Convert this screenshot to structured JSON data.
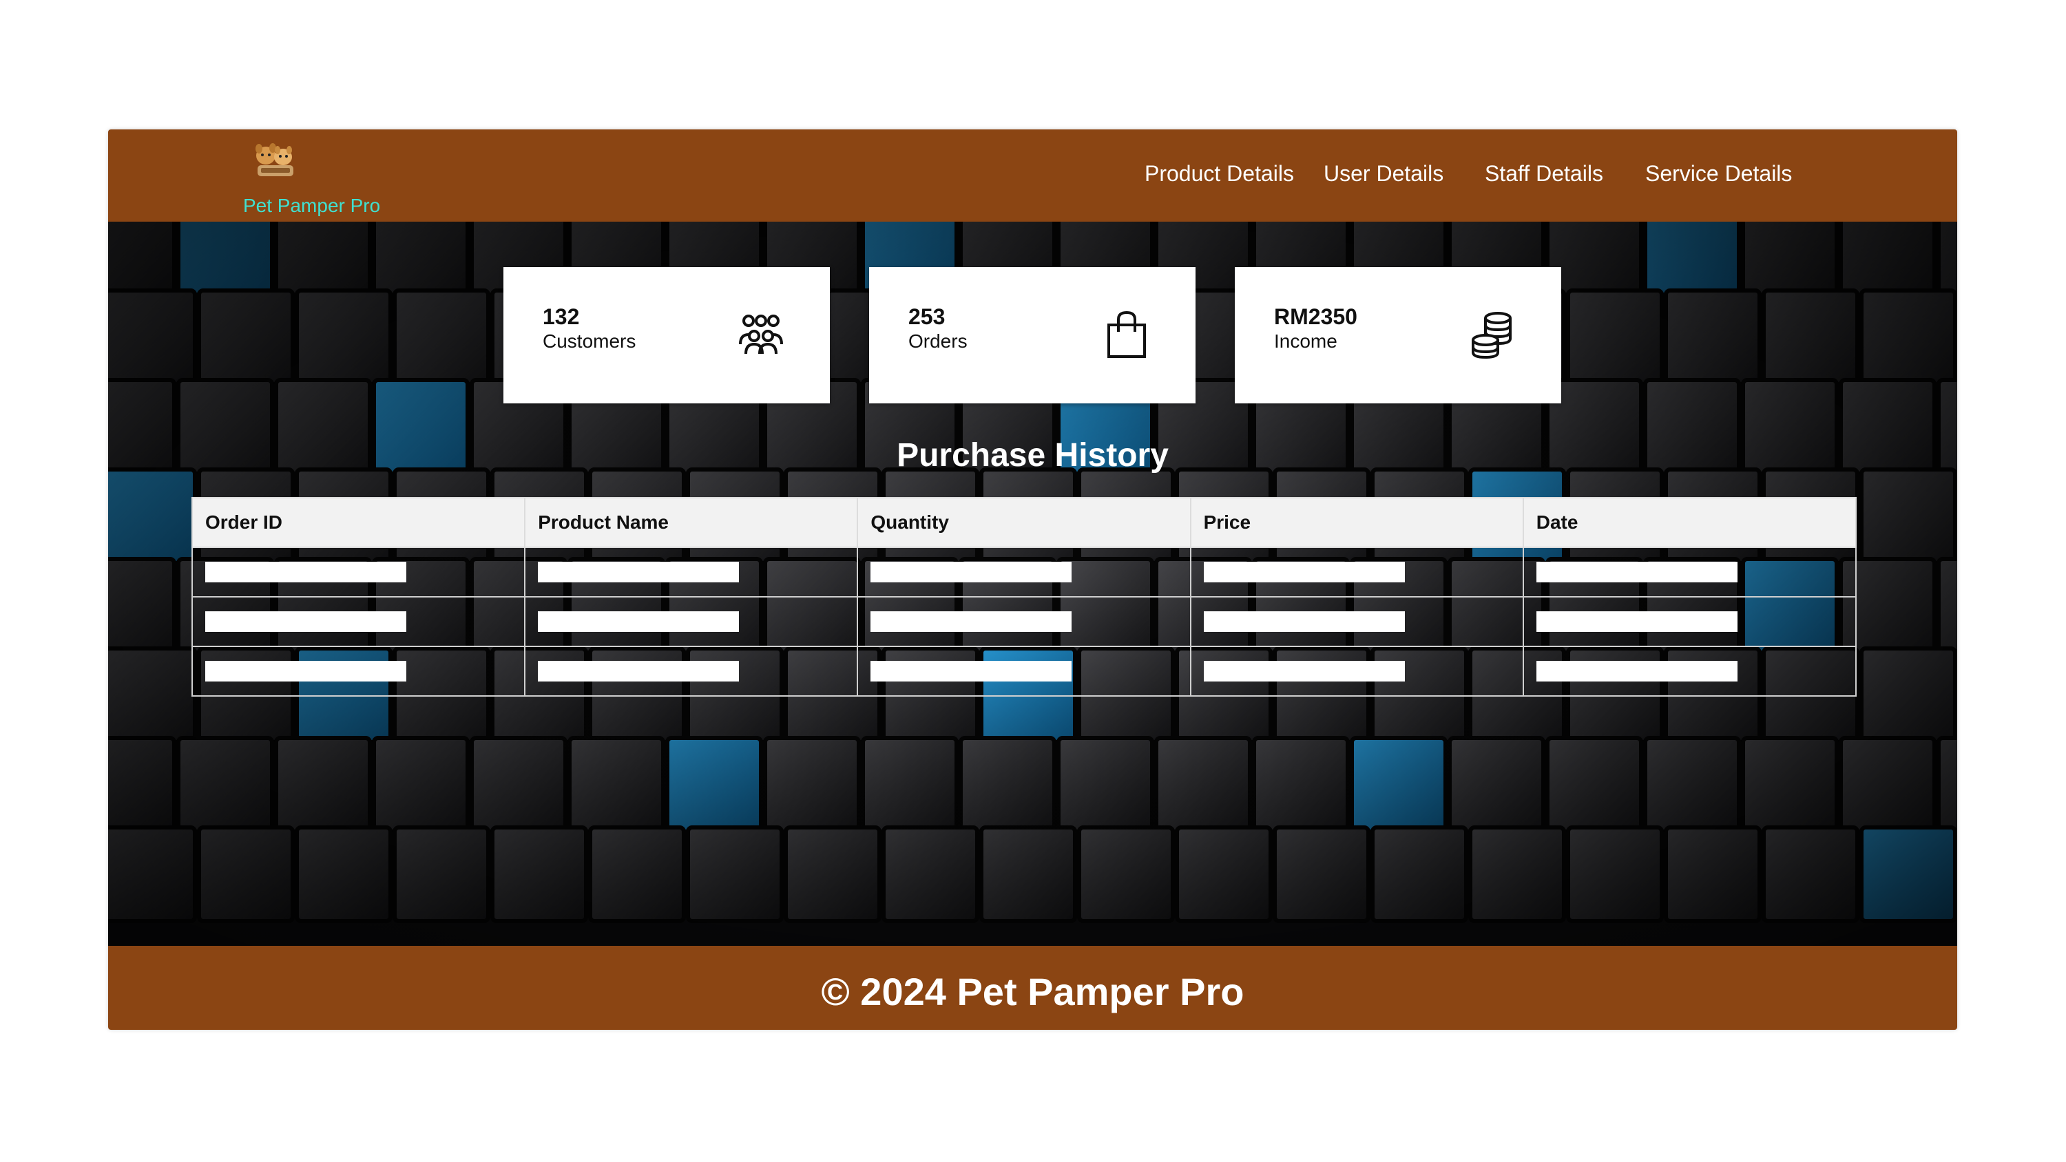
{
  "colors": {
    "header_bg": "#8B4513",
    "brand": "#40E0D0",
    "card_bg": "#FFFFFF",
    "accent_cube": "#1E88C8"
  },
  "header": {
    "brand_name": "Pet Pamper Pro",
    "logo_icon": "pets-logo-icon",
    "nav": [
      {
        "label": "Product Details"
      },
      {
        "label": "User Details"
      },
      {
        "label": "Staff Details"
      },
      {
        "label": "Service Details"
      }
    ]
  },
  "stats": [
    {
      "value": "132",
      "label": "Customers",
      "icon": "people-group-icon"
    },
    {
      "value": "253",
      "label": "Orders",
      "icon": "shopping-bag-icon"
    },
    {
      "value": "RM2350",
      "label": "Income",
      "icon": "coin-stack-icon"
    }
  ],
  "purchase_history": {
    "title": "Purchase History",
    "columns": [
      "Order ID",
      "Product Name",
      "Quantity",
      "Price",
      "Date"
    ],
    "rows": [
      [
        "",
        "",
        "",
        "",
        ""
      ],
      [
        "",
        "",
        "",
        "",
        ""
      ],
      [
        "",
        "",
        "",
        "",
        ""
      ]
    ]
  },
  "footer": {
    "text": "© 2024 Pet Pamper Pro"
  }
}
